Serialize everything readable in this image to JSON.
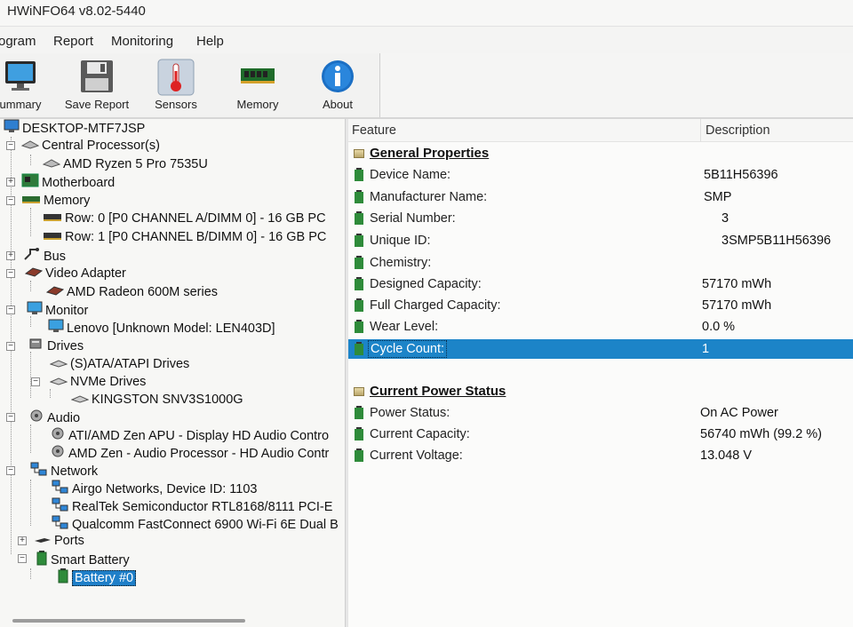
{
  "window": {
    "title": "HWiNFO64 v8.02-5440"
  },
  "menu": {
    "items": [
      "ogram",
      "Report",
      "Monitoring",
      "Help"
    ]
  },
  "toolbar": {
    "buttons": [
      {
        "label": "ummary",
        "icon": "monitor-icon"
      },
      {
        "label": "Save Report",
        "icon": "floppy-disk-icon"
      },
      {
        "label": "Sensors",
        "icon": "thermometer-icon"
      },
      {
        "label": "Memory",
        "icon": "memory-module-icon"
      },
      {
        "label": "About",
        "icon": "info-icon"
      }
    ]
  },
  "tree": {
    "nodes": [
      {
        "label": "DESKTOP-MTF7JSP",
        "icon": "computer-icon"
      },
      {
        "label": "Central Processor(s)",
        "icon": "cpu-icon"
      },
      {
        "label": "AMD Ryzen 5 Pro 7535U",
        "icon": "cpu-icon"
      },
      {
        "label": "Motherboard",
        "icon": "motherboard-icon"
      },
      {
        "label": "Memory",
        "icon": "memory-icon"
      },
      {
        "label": "Row: 0 [P0 CHANNEL A/DIMM 0] - 16 GB PC",
        "icon": "memory-icon"
      },
      {
        "label": "Row: 1 [P0 CHANNEL B/DIMM 0] - 16 GB PC",
        "icon": "memory-icon"
      },
      {
        "label": "Bus",
        "icon": "bus-icon"
      },
      {
        "label": "Video Adapter",
        "icon": "video-card-icon"
      },
      {
        "label": "AMD Radeon 600M series",
        "icon": "video-card-icon"
      },
      {
        "label": "Monitor",
        "icon": "monitor-icon"
      },
      {
        "label": "Lenovo [Unknown Model: LEN403D]",
        "icon": "monitor-icon"
      },
      {
        "label": "Drives",
        "icon": "drive-icon"
      },
      {
        "label": "(S)ATA/ATAPI Drives",
        "icon": "drive-icon"
      },
      {
        "label": "NVMe Drives",
        "icon": "drive-icon"
      },
      {
        "label": "KINGSTON SNV3S1000G",
        "icon": "drive-icon"
      },
      {
        "label": "Audio",
        "icon": "speaker-icon"
      },
      {
        "label": "ATI/AMD Zen APU - Display HD Audio Contro",
        "icon": "speaker-icon"
      },
      {
        "label": "AMD Zen - Audio Processor - HD Audio Contr",
        "icon": "speaker-icon"
      },
      {
        "label": "Network",
        "icon": "network-icon"
      },
      {
        "label": "Airgo Networks, Device ID: 1103",
        "icon": "network-icon"
      },
      {
        "label": "RealTek Semiconductor RTL8168/8111 PCI-E",
        "icon": "network-icon"
      },
      {
        "label": "Qualcomm FastConnect 6900 Wi-Fi 6E Dual B",
        "icon": "network-icon"
      },
      {
        "label": "Ports",
        "icon": "port-icon"
      },
      {
        "label": "Smart Battery",
        "icon": "battery-icon"
      },
      {
        "label": "Battery #0",
        "icon": "battery-icon"
      }
    ]
  },
  "details": {
    "columns": {
      "feature": "Feature",
      "description": "Description"
    },
    "sections": [
      {
        "title": "General Properties",
        "rows": [
          {
            "feature": "Device Name:",
            "value": "5B11H56396"
          },
          {
            "feature": "Manufacturer Name:",
            "value": "SMP"
          },
          {
            "feature": "Serial Number:",
            "value": "3"
          },
          {
            "feature": "Unique ID:",
            "value": "3SMP5B11H56396"
          },
          {
            "feature": "Chemistry:",
            "value": ""
          },
          {
            "feature": "Designed Capacity:",
            "value": "57170 mWh"
          },
          {
            "feature": "Full Charged Capacity:",
            "value": "57170 mWh"
          },
          {
            "feature": "Wear Level:",
            "value": "0.0 %"
          },
          {
            "feature": "Cycle Count:",
            "value": "1"
          }
        ]
      },
      {
        "title": "Current Power Status",
        "rows": [
          {
            "feature": "Power Status:",
            "value": "On AC Power"
          },
          {
            "feature": "Current Capacity:",
            "value": "56740 mWh (99.2 %)"
          },
          {
            "feature": "Current Voltage:",
            "value": "13.048 V"
          }
        ]
      }
    ]
  },
  "colors": {
    "selection": "#1c84c8",
    "battery_green": "#2e8b3a"
  }
}
